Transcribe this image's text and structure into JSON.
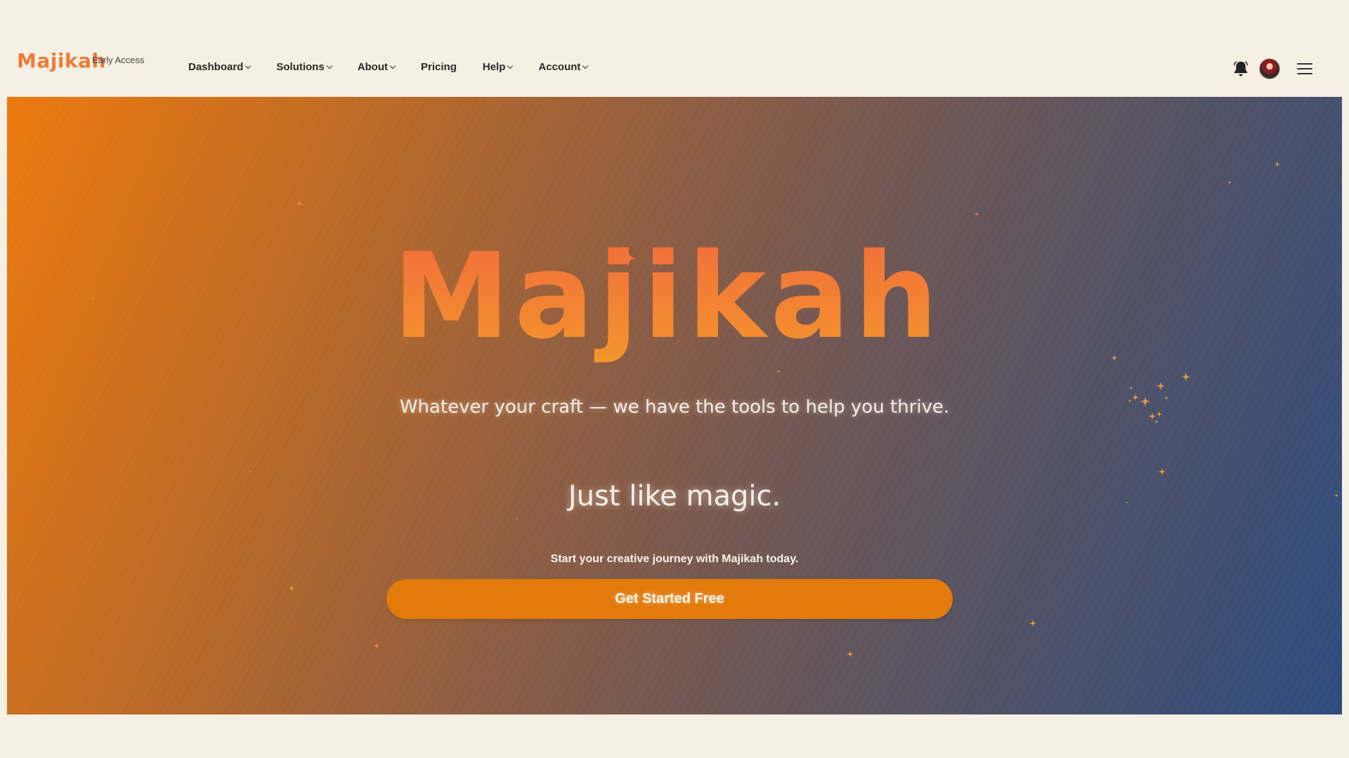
{
  "header": {
    "brand": "Majikah",
    "badge": "Early Access",
    "nav": [
      {
        "label": "Dashboard",
        "has_dropdown": true
      },
      {
        "label": "Solutions",
        "has_dropdown": true
      },
      {
        "label": "About",
        "has_dropdown": true
      },
      {
        "label": "Pricing",
        "has_dropdown": false
      },
      {
        "label": "Help",
        "has_dropdown": true
      },
      {
        "label": "Account",
        "has_dropdown": true
      }
    ],
    "icons": [
      "bell-icon",
      "avatar",
      "menu-icon"
    ]
  },
  "hero": {
    "wordmark": "Majikah",
    "tagline": "Whatever your craft — we have the tools to help you thrive.",
    "headline": "Just like magic.",
    "subtext": "Start your creative journey with Majikah today.",
    "cta_label": "Get Started Free"
  },
  "colors": {
    "page_background": "#f6efe3",
    "brand": "#ec7b3a",
    "gradient_start": "#ec790d",
    "gradient_end": "#2e4c7f",
    "cta": "#e27a0c",
    "sparkle": "#f2a23a"
  }
}
